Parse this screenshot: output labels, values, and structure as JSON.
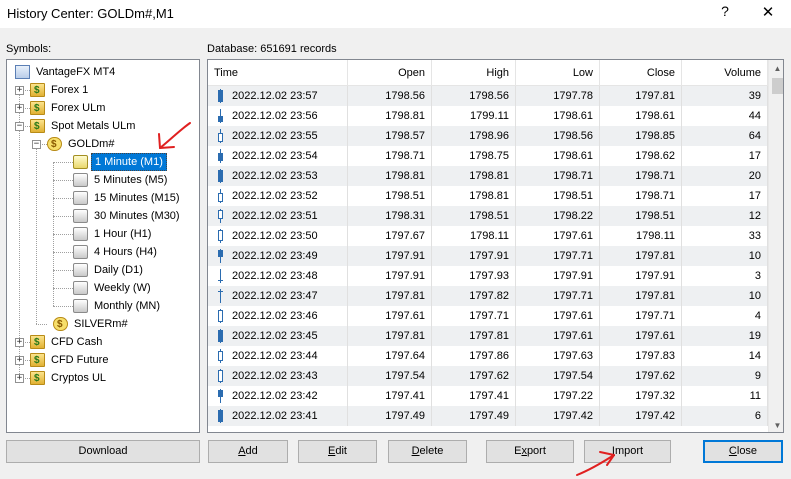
{
  "window": {
    "title": "History Center: GOLDm#,M1",
    "help_glyph": "?",
    "close_glyph": "✕"
  },
  "symbols_label": "Symbols:",
  "database_label": "Database: 651691 records",
  "tree": {
    "root": "VantageFX MT4",
    "groups": [
      "Forex 1",
      "Forex ULm",
      "Spot Metals ULm"
    ],
    "symbol": "GOLDm#",
    "timeframes": [
      "1 Minute (M1)",
      "5 Minutes (M5)",
      "15 Minutes (M15)",
      "30 Minutes (M30)",
      "1 Hour (H1)",
      "4 Hours (H4)",
      "Daily (D1)",
      "Weekly (W)",
      "Monthly (MN)"
    ],
    "symbol2": "SILVERm#",
    "groups2": [
      "CFD Cash",
      "CFD Future",
      "Cryptos UL"
    ]
  },
  "table": {
    "columns": [
      "Time",
      "Open",
      "High",
      "Low",
      "Close",
      "Volume"
    ],
    "rows": [
      [
        "2022.12.02 23:57",
        "1798.56",
        "1798.56",
        "1797.78",
        "1797.81",
        "39"
      ],
      [
        "2022.12.02 23:56",
        "1798.81",
        "1799.11",
        "1798.61",
        "1798.61",
        "44"
      ],
      [
        "2022.12.02 23:55",
        "1798.57",
        "1798.96",
        "1798.56",
        "1798.85",
        "64"
      ],
      [
        "2022.12.02 23:54",
        "1798.71",
        "1798.75",
        "1798.61",
        "1798.62",
        "17"
      ],
      [
        "2022.12.02 23:53",
        "1798.81",
        "1798.81",
        "1798.71",
        "1798.71",
        "20"
      ],
      [
        "2022.12.02 23:52",
        "1798.51",
        "1798.81",
        "1798.51",
        "1798.71",
        "17"
      ],
      [
        "2022.12.02 23:51",
        "1798.31",
        "1798.51",
        "1798.22",
        "1798.51",
        "12"
      ],
      [
        "2022.12.02 23:50",
        "1797.67",
        "1798.11",
        "1797.61",
        "1798.11",
        "33"
      ],
      [
        "2022.12.02 23:49",
        "1797.91",
        "1797.91",
        "1797.71",
        "1797.81",
        "10"
      ],
      [
        "2022.12.02 23:48",
        "1797.91",
        "1797.93",
        "1797.91",
        "1797.91",
        "3"
      ],
      [
        "2022.12.02 23:47",
        "1797.81",
        "1797.82",
        "1797.71",
        "1797.81",
        "10"
      ],
      [
        "2022.12.02 23:46",
        "1797.61",
        "1797.71",
        "1797.61",
        "1797.71",
        "4"
      ],
      [
        "2022.12.02 23:45",
        "1797.81",
        "1797.81",
        "1797.61",
        "1797.61",
        "19"
      ],
      [
        "2022.12.02 23:44",
        "1797.64",
        "1797.86",
        "1797.63",
        "1797.83",
        "14"
      ],
      [
        "2022.12.02 23:43",
        "1797.54",
        "1797.62",
        "1797.54",
        "1797.62",
        "9"
      ],
      [
        "2022.12.02 23:42",
        "1797.41",
        "1797.41",
        "1797.22",
        "1797.32",
        "11"
      ],
      [
        "2022.12.02 23:41",
        "1797.49",
        "1797.49",
        "1797.42",
        "1797.42",
        "6"
      ]
    ]
  },
  "buttons": {
    "download": "Download",
    "add_first": "A",
    "add_rest": "dd",
    "edit_first": "E",
    "edit_rest": "dit",
    "delete_first": "D",
    "delete_rest": "elete",
    "export_pre": "E",
    "export_u": "x",
    "export_post": "port",
    "import_first": "I",
    "import_rest": "mport",
    "close_first": "C",
    "close_rest": "lose"
  },
  "colors": {
    "selection": "#0078d7",
    "annotation": "#e02020"
  }
}
